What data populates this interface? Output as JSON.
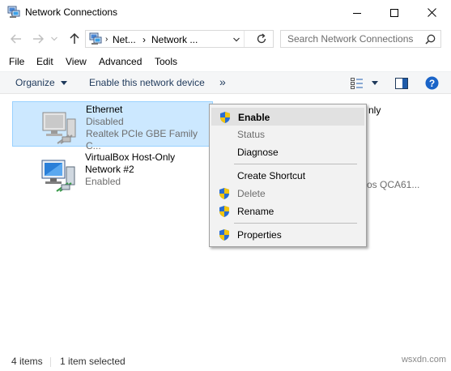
{
  "window": {
    "title": "Network Connections",
    "icons": {
      "app": "network-connections-icon",
      "minimize": "minimize-icon",
      "maximize": "maximize-icon",
      "close": "close-icon"
    }
  },
  "address": {
    "crumbs": [
      "Net...",
      "Network ..."
    ],
    "search_placeholder": "Search Network Connections"
  },
  "menu": [
    "File",
    "Edit",
    "View",
    "Advanced",
    "Tools"
  ],
  "toolbar": {
    "organize": "Organize",
    "enable_device": "Enable this network device",
    "more": "»"
  },
  "connections": [
    {
      "name": "Ethernet",
      "status": "Disabled",
      "device": "Realtek PCIe GBE Family C...",
      "selected": true
    },
    {
      "name": "VirtualBox Host-Only Network #2",
      "name_line1": "VirtualBox Host-Only",
      "name_line2": "Network #2",
      "status": "Enabled",
      "device": ""
    }
  ],
  "partial_texts": {
    "right_top": "nly",
    "right_bottom": "os QCA61..."
  },
  "context_menu": [
    {
      "label": "Enable",
      "shield": true,
      "bold": true,
      "disabled": false,
      "hover": true
    },
    {
      "label": "Status",
      "shield": false,
      "bold": false,
      "disabled": true
    },
    {
      "label": "Diagnose",
      "shield": false,
      "bold": false,
      "disabled": false
    },
    {
      "label": "Create Shortcut",
      "shield": false,
      "bold": false,
      "disabled": false
    },
    {
      "label": "Delete",
      "shield": true,
      "bold": false,
      "disabled": true
    },
    {
      "label": "Rename",
      "shield": true,
      "bold": false,
      "disabled": false
    },
    {
      "label": "Properties",
      "shield": true,
      "bold": false,
      "disabled": false
    }
  ],
  "status": {
    "items": "4 items",
    "selected": "1 item selected",
    "watermark": "wsxdn.com"
  },
  "colors": {
    "selection": "#cce8ff",
    "selection_border": "#99d1ff",
    "help_blue": "#1a64c8",
    "shield_blue": "#2a6dd2",
    "shield_yellow": "#f2c50f"
  }
}
